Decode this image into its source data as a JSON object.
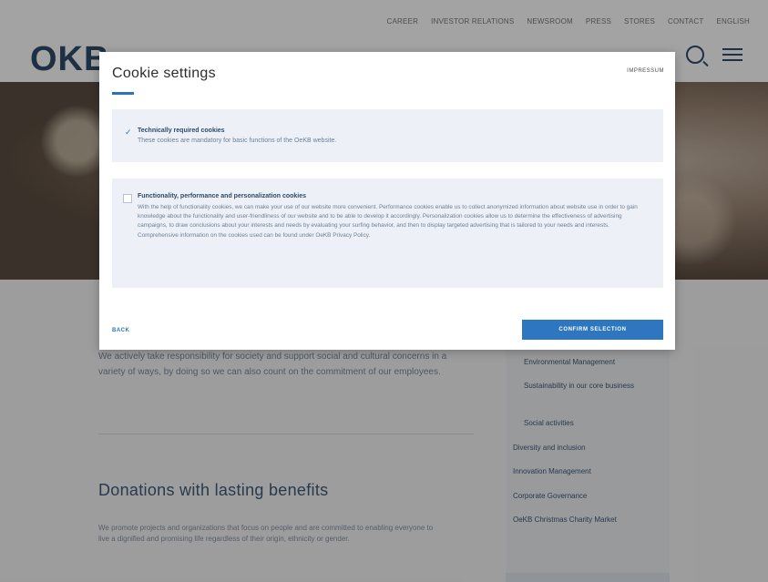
{
  "topnav": {
    "links": [
      "CAREER",
      "INVESTOR RELATIONS",
      "NEWSROOM",
      "PRESS",
      "STORES",
      "CONTACT",
      "ENGLISH"
    ],
    "logo": "OKB"
  },
  "page": {
    "intro_text": "We actively take responsibility for society and support social and cultural concerns in a variety of ways, by doing so we can also count on the commitment of our employees.",
    "donations_title": "Donations with lasting benefits",
    "donations_text": "We promote projects and organizations that focus on people and are committed to enabling everyone to live a dignified and promising life regardless of their origin, ethnicity or gender.",
    "sidebar": {
      "items": [
        "Environmental Management",
        "Sustainability in our core business",
        "Social activities",
        "Diversity and inclusion",
        "Innovation Management",
        "Corporate Governance",
        "OeKB Christmas Charity Market"
      ]
    }
  },
  "modal": {
    "title": "Cookie settings",
    "imprint": "IMPRESSUM",
    "required": {
      "title": "Technically required cookies",
      "description": "These cookies are mandatory for basic functions of the OeKB website."
    },
    "optional": {
      "title": "Functionality, performance and personalization cookies",
      "description": "With the help of functionality cookies, we can make your use of our website more convenient. Performance cookies enable us to collect anonymized information about website use in order to gain knowledge about the functionality and user-friendliness of our website and to be able to develop it accordingly. Personalization cookies allow us to determine the effectiveness of advertising campaigns, to draw conclusions about your interests and needs by evaluating your surfing behavior, and then to display targeted advertising that is tailored to your needs and interests. Comprehensive information on the cookies used can be found under OeKB Privacy Policy."
    },
    "back_label": "BACK",
    "confirm_label": "CONFIRM SELECTION"
  },
  "colors": {
    "accent": "#2e76bf",
    "overlay": "#232323"
  }
}
